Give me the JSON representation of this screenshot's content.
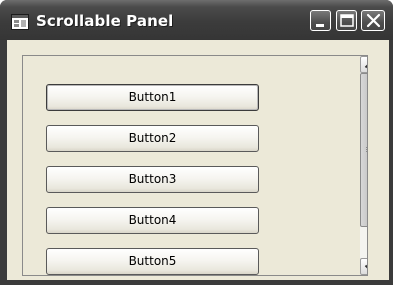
{
  "window": {
    "title": "Scrollable Panel"
  },
  "caption_buttons": [
    {
      "name": "minimize",
      "icon": "minimize-icon"
    },
    {
      "name": "maximize",
      "icon": "maximize-icon"
    },
    {
      "name": "close",
      "icon": "close-icon"
    }
  ],
  "panel": {
    "buttons": [
      {
        "label": "Button1",
        "focused": true
      },
      {
        "label": "Button2",
        "focused": false
      },
      {
        "label": "Button3",
        "focused": false
      },
      {
        "label": "Button4",
        "focused": false
      },
      {
        "label": "Button5",
        "focused": false
      }
    ],
    "scrollbar": {
      "orientation": "vertical",
      "up_icon": "chevron-up-icon",
      "down_icon": "chevron-down-icon",
      "position_fraction": 0.0,
      "visible_fraction": 0.83
    }
  },
  "colors": {
    "titlebar": "#3c3c3c",
    "client": "#ece9d8",
    "button_border": "#5a5a5a"
  }
}
